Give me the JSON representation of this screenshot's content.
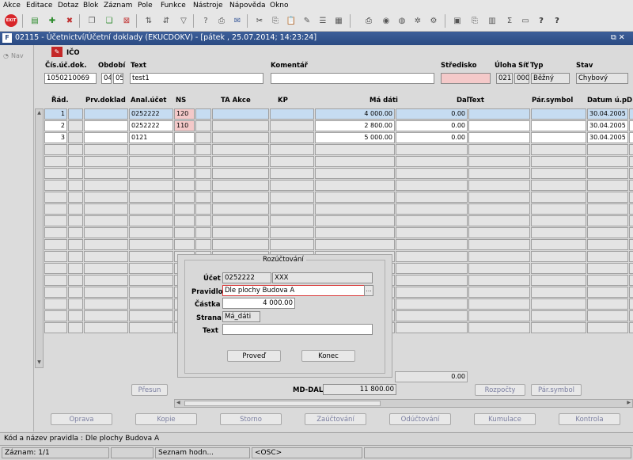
{
  "menu": [
    "Akce",
    "Editace",
    "Dotaz",
    "Blok",
    "Záznam",
    "Pole",
    "Funkce",
    "Nástroje",
    "Nápověda",
    "Okno"
  ],
  "toolbar": {
    "exit_label": "EXIT"
  },
  "window": {
    "title": "02115 - Účetnictví/Účetní doklady (EKUCDOKV) - [pátek , 25.07.2014; 14:23:24]",
    "controls": "⧉ ✕"
  },
  "left": {
    "nav_label": "Nav"
  },
  "header": {
    "ico_label": "IČO",
    "labels": {
      "doc": "Čís.úč.dok.",
      "period": "Období",
      "text": "Text",
      "comment": "Komentář",
      "center": "Středisko",
      "task": "Úloha",
      "net": "Síť",
      "type": "Typ",
      "state": "Stav"
    },
    "values": {
      "doc": "1050210069",
      "period_a": "04",
      "period_b": "05",
      "text": "test1",
      "comment": "",
      "center": "",
      "task": "021",
      "net": "000",
      "type": "Běžný",
      "state": "Chybový"
    }
  },
  "grid": {
    "headers": {
      "row": "Řád.",
      "prv": "Prv.doklad",
      "anal": "Anal.účet",
      "ns": "NS",
      "ta": "TA Akce",
      "kp": "KP",
      "ma_dati": "Má dáti",
      "dal": "Dal",
      "text": "Text",
      "par": "Pár.symbol",
      "datum": "Datum ú.p.",
      "d": "D"
    },
    "rows": [
      {
        "row": "1",
        "anal": "0252222",
        "ns": "120",
        "ma_dati": "4 000.00",
        "dal": "0.00",
        "datum": "30.04.2005"
      },
      {
        "row": "2",
        "anal": "0252222",
        "ns": "110",
        "ma_dati": "2 800.00",
        "dal": "0.00",
        "datum": "30.04.2005"
      },
      {
        "row": "3",
        "anal": "0121",
        "ns": "",
        "ma_dati": "5 000.00",
        "dal": "0.00",
        "datum": "30.04.2005"
      }
    ],
    "dal_total": "0.00"
  },
  "dialog": {
    "title": "Rozúčtování",
    "labels": {
      "ucet": "Účet",
      "pravidlo": "Pravidlo",
      "castka": "Částka",
      "strana": "Strana",
      "text": "Text"
    },
    "values": {
      "ucet": "0252222",
      "ucet_name": "XXX",
      "pravidlo": "Dle plochy Budova A",
      "castka": "4 000.00",
      "strana": "Má_dáti",
      "text": ""
    },
    "buttons": {
      "proved": "Proveď",
      "konec": "Konec"
    },
    "lov": "…"
  },
  "footer": {
    "presun": "Přesun",
    "mddal_label": "MD-DAL",
    "mddal_value": "11 800.00",
    "rozpocty": "Rozpočty",
    "parsymbol": "Pár.symbol",
    "buttons": [
      "Oprava",
      "Kopie",
      "Storno",
      "Zaúčtování",
      "Odúčtování",
      "Kumulace",
      "Kontrola"
    ]
  },
  "status": {
    "hint": "Kód a název pravidla : Dle plochy Budova A",
    "record": "Záznam: 1/1",
    "list": "Seznam hodn...",
    "osc": "<OSC>"
  },
  "colors": {
    "title_bar": "#2a4a82",
    "selected_row": "#c6dcf1",
    "error_field": "#f4c9c9",
    "disabled_button": "#7a7ea0"
  }
}
